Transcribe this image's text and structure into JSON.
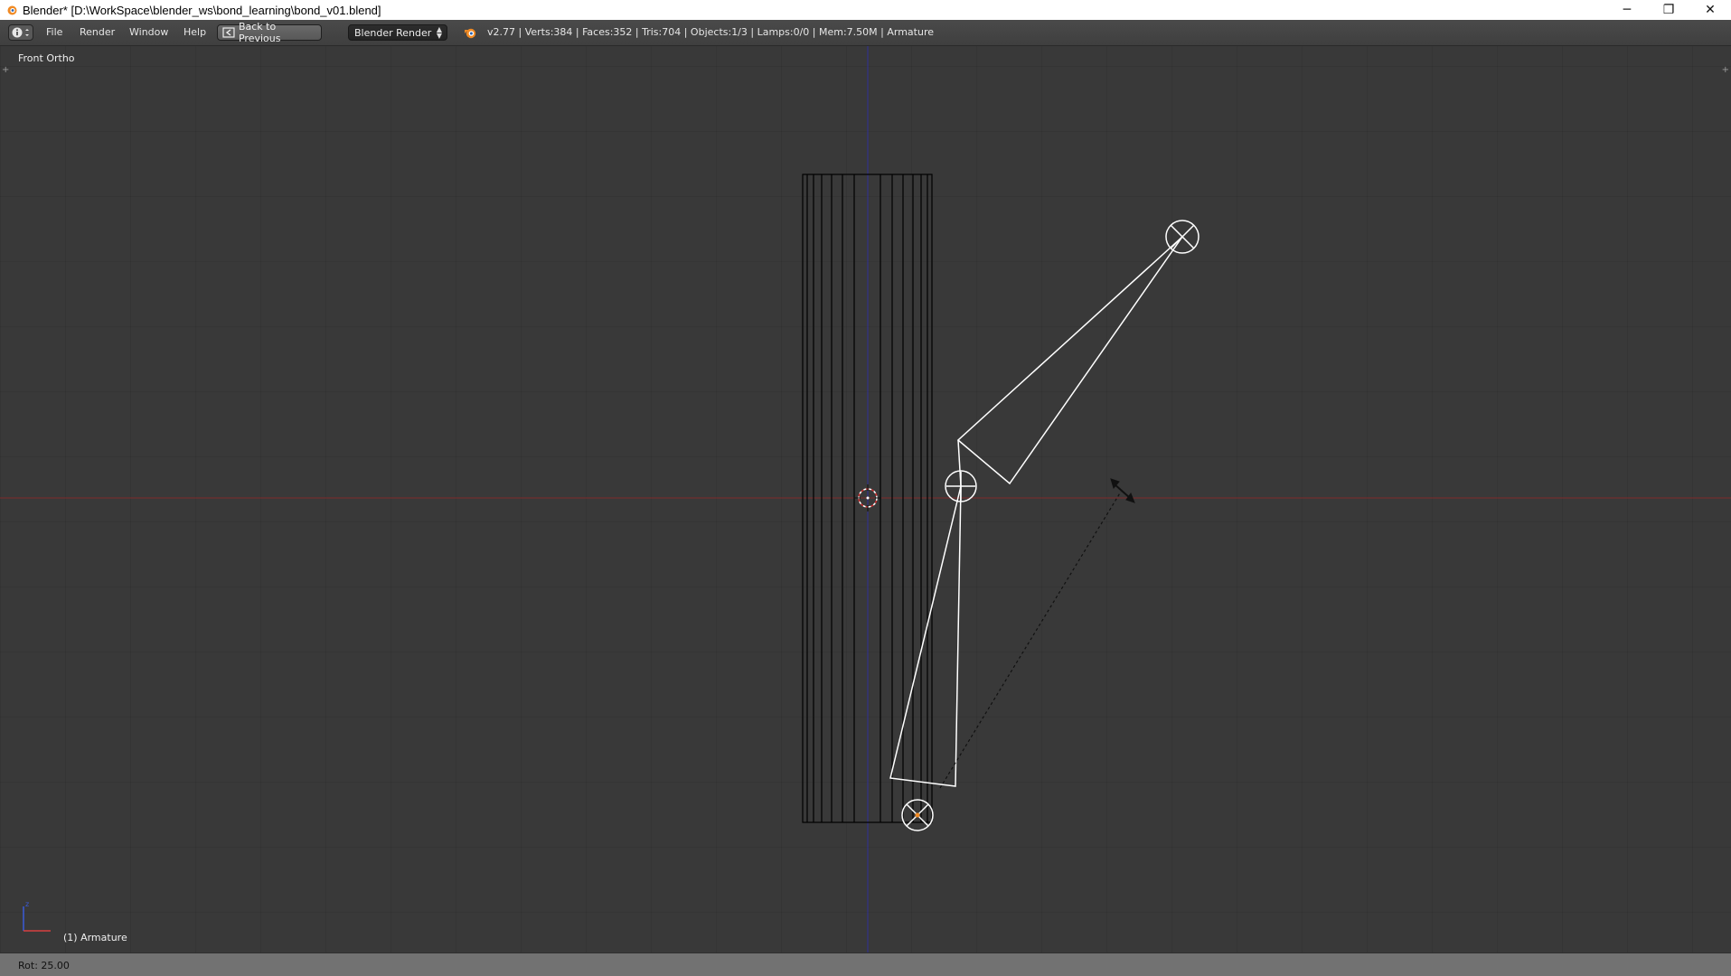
{
  "window": {
    "title": "Blender* [D:\\WorkSpace\\blender_ws\\bond_learning\\bond_v01.blend]",
    "controls": {
      "minimize": "─",
      "restore": "❐",
      "close": "✕"
    }
  },
  "header": {
    "editor_type_icon": "info-icon",
    "menus": [
      "File",
      "Render",
      "Window",
      "Help"
    ],
    "back_button": "Back to Previous",
    "render_engine": "Blender Render",
    "stats": "v2.77 | Verts:384 | Faces:352 | Tris:704 | Objects:1/3 | Lamps:0/0 | Mem:7.50M | Armature"
  },
  "viewport": {
    "view_label": "Front Ortho",
    "active_object": "(1) Armature",
    "axes": {
      "x_color": "#8b2a2a",
      "z_color": "#2a2aa0"
    }
  },
  "status": {
    "text": "Rot: 25.00"
  },
  "colors": {
    "background": "#393939",
    "header": "#454545",
    "statusbar": "#727272",
    "bone_wire": "#ffffff",
    "mesh_wire": "#000000",
    "accent_orange": "#f08a24"
  }
}
